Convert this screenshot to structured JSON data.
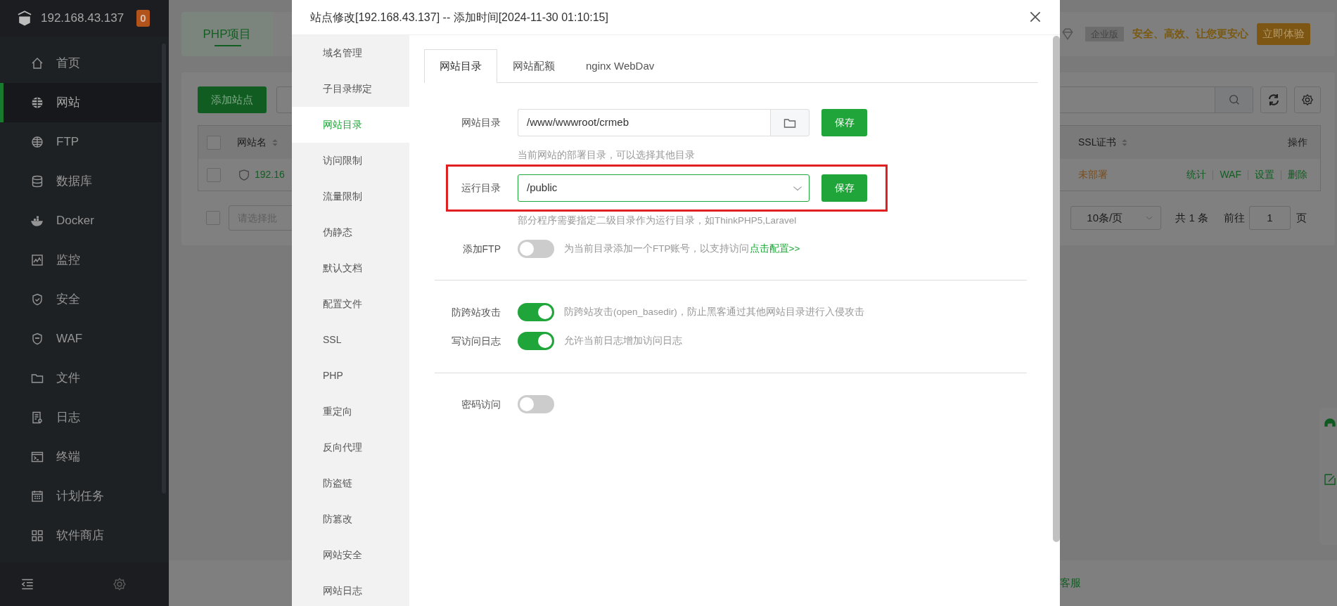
{
  "sidebar": {
    "host": "192.168.43.137",
    "badge": "0",
    "items": [
      {
        "label": "首页",
        "selected": false
      },
      {
        "label": "网站",
        "selected": true
      },
      {
        "label": "FTP",
        "selected": false
      },
      {
        "label": "数据库",
        "selected": false
      },
      {
        "label": "Docker",
        "selected": false
      },
      {
        "label": "监控",
        "selected": false
      },
      {
        "label": "安全",
        "selected": false
      },
      {
        "label": "WAF",
        "selected": false
      },
      {
        "label": "文件",
        "selected": false
      },
      {
        "label": "日志",
        "selected": false
      },
      {
        "label": "终端",
        "selected": false
      },
      {
        "label": "计划任务",
        "selected": false
      },
      {
        "label": "软件商店",
        "selected": false
      }
    ]
  },
  "page": {
    "tabs": [
      {
        "label": "PHP项目",
        "selected": true
      }
    ],
    "promo": {
      "edition": "企业版",
      "slogan": "安全、高效、让您更安心",
      "button": "立即体验"
    },
    "add_button": "添加站点",
    "table": {
      "header_checked": false,
      "columns": [
        "网站名",
        "SSL证书",
        "操作"
      ],
      "rows": [
        {
          "checked": false,
          "name": "192.16",
          "ssl": "未部署",
          "actions": [
            "统计",
            "WAF",
            "设置",
            "删除"
          ]
        }
      ]
    },
    "batch": {
      "checked": false,
      "placeholder": "请选择批"
    },
    "pagination": {
      "page_size": "10条/页",
      "total": "共 1 条",
      "goto": "前往",
      "page": "1",
      "unit": "页"
    },
    "footer_link": "客服"
  },
  "dialog": {
    "title": "站点修改[192.168.43.137] -- 添加时间[2024-11-30 01:10:15]",
    "nav": [
      {
        "label": "域名管理",
        "selected": false
      },
      {
        "label": "子目录绑定",
        "selected": false
      },
      {
        "label": "网站目录",
        "selected": true
      },
      {
        "label": "访问限制",
        "selected": false
      },
      {
        "label": "流量限制",
        "selected": false
      },
      {
        "label": "伪静态",
        "selected": false
      },
      {
        "label": "默认文档",
        "selected": false
      },
      {
        "label": "配置文件",
        "selected": false
      },
      {
        "label": "SSL",
        "selected": false
      },
      {
        "label": "PHP",
        "selected": false
      },
      {
        "label": "重定向",
        "selected": false
      },
      {
        "label": "反向代理",
        "selected": false
      },
      {
        "label": "防盗链",
        "selected": false
      },
      {
        "label": "防篡改",
        "selected": false
      },
      {
        "label": "网站安全",
        "selected": false
      },
      {
        "label": "网站日志",
        "selected": false
      }
    ],
    "tabs": [
      {
        "label": "网站目录",
        "selected": true
      },
      {
        "label": "网站配额",
        "selected": false
      },
      {
        "label": "nginx WebDav",
        "selected": false
      }
    ],
    "form": [
      {
        "kind": "path",
        "label": "网站目录",
        "value": "/www/wwwroot/crmeb",
        "button": "保存",
        "hint": "当前网站的部署目录，可以选择其他目录"
      },
      {
        "kind": "select",
        "label": "运行目录",
        "value": "/public",
        "button": "保存",
        "highlighted": true,
        "hint": "部分程序需要指定二级目录作为运行目录，如ThinkPHP5,Laravel"
      },
      {
        "kind": "toggle",
        "label": "添加FTP",
        "on": false,
        "note": "为当前目录添加一个FTP账号，以支持访问",
        "link": "点击配置>>"
      },
      {
        "kind": "divider"
      },
      {
        "kind": "toggle",
        "label": "防跨站攻击",
        "on": true,
        "note": "防跨站攻击(open_basedir)，防止黑客通过其他网站目录进行入侵攻击"
      },
      {
        "kind": "toggle",
        "label": "写访问日志",
        "on": true,
        "note": "允许当前日志增加访问日志"
      },
      {
        "kind": "divider"
      },
      {
        "kind": "toggle",
        "label": "密码访问",
        "on": false
      }
    ]
  }
}
